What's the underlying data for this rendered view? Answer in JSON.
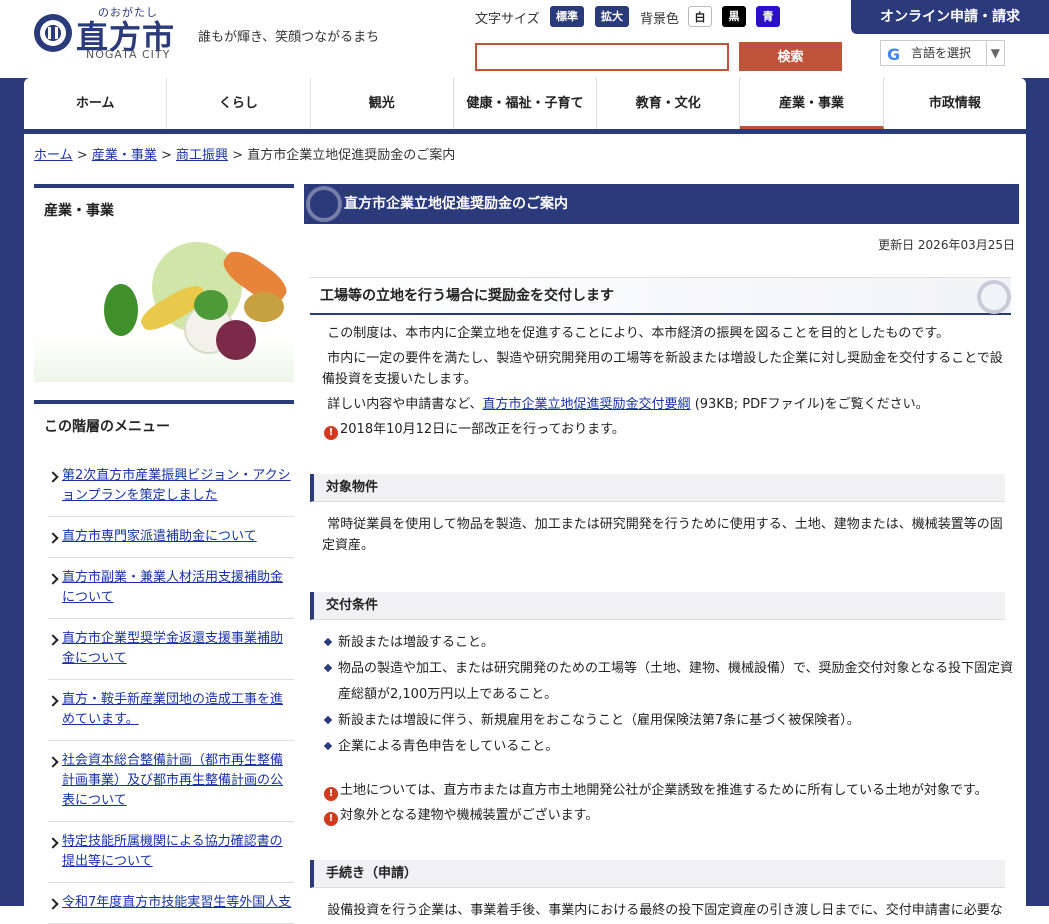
{
  "header": {
    "ruby": "のおがたし",
    "city_name": "直方市",
    "city_en": "NOGATA CITY",
    "tagline": "誰もが輝き、笑顔つながるまち",
    "font_size_label": "文字サイズ",
    "font_standard": "標準",
    "font_large": "拡大",
    "bg_label": "背景色",
    "bg_white": "白",
    "bg_black": "黒",
    "bg_blue": "青",
    "online_label": "オンライン申請・請求",
    "search_placeholder": "",
    "search_button": "検索",
    "translate_label": "言語を選択",
    "translate_g": "G",
    "translate_arrow": "▼"
  },
  "nav": {
    "items": [
      "ホーム",
      "くらし",
      "観光",
      "健康・福祉・子育て",
      "教育・文化",
      "産業・事業",
      "市政情報"
    ],
    "active_index": 5
  },
  "breadcrumb": {
    "home": "ホーム",
    "l1": "産業・事業",
    "l2": "商工振興",
    "current": "直方市企業立地促進奨励金のご案内",
    "sep": ">"
  },
  "sidebar": {
    "title": "産業・事業",
    "menu_title": "この階層のメニュー",
    "items": [
      "第2次直方市産業振興ビジョン・アクションプランを策定しました",
      "直方市専門家派遣補助金について",
      "直方市副業・兼業人材活用支援補助金について",
      "直方市企業型奨学金返還支援事業補助金について",
      "直方・鞍手新産業団地の造成工事を進めています。",
      "社会資本総合整備計画（都市再生整備計画事業）及び都市再生整備計画の公表について",
      "特定技能所属機関による協力確認書の提出等について",
      "令和7年度直方市技能実習生等外国人支"
    ]
  },
  "main": {
    "page_title": "直方市企業立地促進奨励金のご案内",
    "updated": "更新日 2026年03月25日",
    "h2": "工場等の立地を行う場合に奨励金を交付します",
    "p1": "この制度は、本市内に企業立地を促進することにより、本市経済の振興を図ることを目的としたものです。",
    "p2": "市内に一定の要件を満たし、製造や研究開発用の工場等を新設または増設した企業に対し奨励金を交付することで設備投資を支援いたします。",
    "p3_pre": "詳しい内容や申請書など、",
    "p3_link": "直方市企業立地促進奨励金交付要綱",
    "p3_post": " (93KB; PDFファイル)をご覧ください。",
    "note1": "2018年10月12日に一部改正を行っております。",
    "warn_mark": "!",
    "h3a": "対象物件",
    "p4": "常時従業員を使用して物品を製造、加工または研究開発を行うために使用する、土地、建物または、機械装置等の固定資産。",
    "h3b": "交付条件",
    "conditions": [
      "新設または増設すること。",
      "物品の製造や加工、または研究開発のための工場等（土地、建物、機械設備）で、奨励金交付対象となる投下固定資産総額が2,100万円以上であること。",
      "新設または増設に伴う、新規雇用をおこなうこと（雇用保険法第7条に基づく被保険者）。",
      "企業による青色申告をしていること。"
    ],
    "note2": "土地については、直方市または直方市土地開発公社が企業誘致を推進するために所有している土地が対象です。",
    "note3": "対象外となる建物や機械装置がございます。",
    "h3c": "手続き（申請）",
    "p5": "設備投資を行う企業は、事業着手後、事業内における最終の投下固定資産の引き渡し日までに、交付申請書に必要な"
  }
}
